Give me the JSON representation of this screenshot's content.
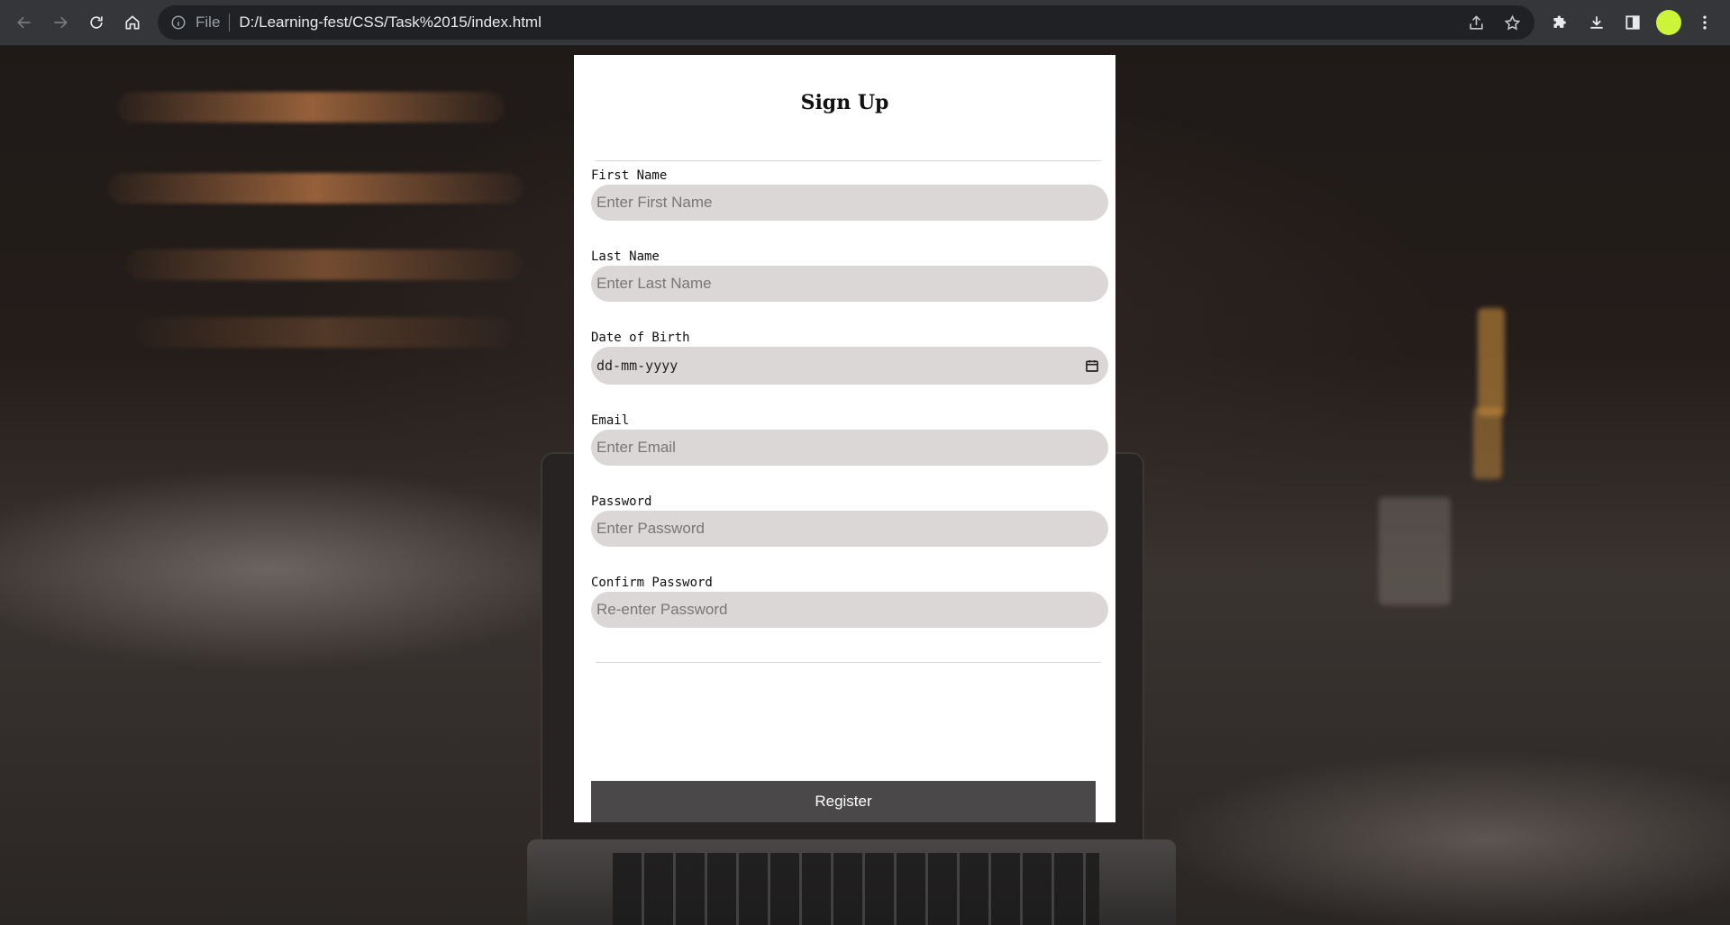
{
  "browser": {
    "scheme_label": "File",
    "url": "D:/Learning-fest/CSS/Task%2015/index.html",
    "profile_color": "#ccf53a"
  },
  "icons": {
    "back": "arrow-left-icon",
    "forward": "arrow-right-icon",
    "reload": "reload-icon",
    "home": "home-icon",
    "info": "info-icon",
    "share": "share-icon",
    "bookmark": "star-icon",
    "extensions": "puzzle-icon",
    "downloads": "download-icon",
    "side_panel": "side-panel-icon",
    "menu": "kebab-menu-icon",
    "calendar": "calendar-icon"
  },
  "form": {
    "title": "Sign Up",
    "fields": {
      "first_name": {
        "label": "First Name",
        "placeholder": "Enter First Name"
      },
      "last_name": {
        "label": "Last Name",
        "placeholder": "Enter Last Name"
      },
      "dob": {
        "label": "Date of Birth",
        "value": "dd-mm-yyyy"
      },
      "email": {
        "label": "Email",
        "placeholder": "Enter Email"
      },
      "password": {
        "label": "Password",
        "placeholder": "Enter Password"
      },
      "confirm_password": {
        "label": "Confirm Password",
        "placeholder": "Re-enter Password"
      }
    },
    "submit_label": "Register"
  }
}
